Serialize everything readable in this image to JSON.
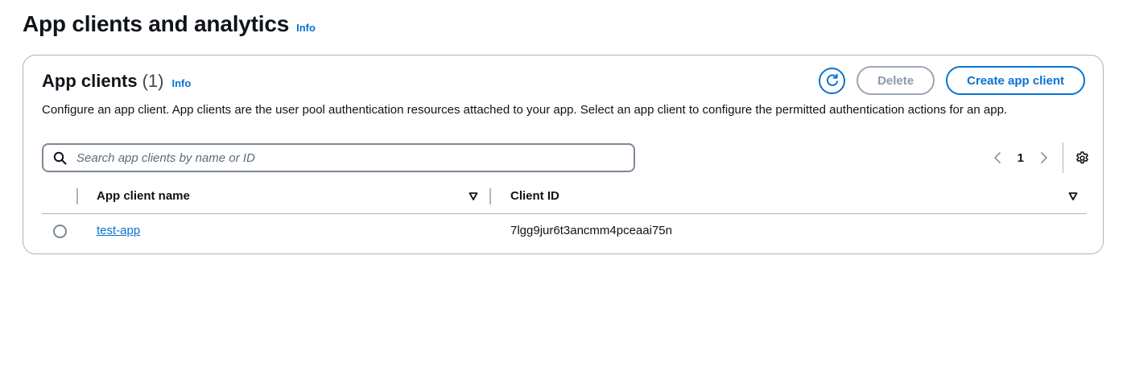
{
  "page": {
    "title": "App clients and analytics",
    "info_label": "Info"
  },
  "app_clients": {
    "title": "App clients",
    "count": "(1)",
    "info_label": "Info",
    "description": "Configure an app client. App clients are the user pool authentication resources attached to your app. Select an app client to configure the permitted authentication actions for an app.",
    "actions": {
      "refresh_icon": "refresh-icon",
      "delete_label": "Delete",
      "create_label": "Create app client"
    },
    "search": {
      "placeholder": "Search app clients by name or ID",
      "value": ""
    },
    "pagination": {
      "current_page": "1"
    },
    "table": {
      "columns": [
        "App client name",
        "Client ID"
      ],
      "rows": [
        {
          "name": "test-app",
          "client_id": "7lgg9jur6t3ancmm4pceaai75n"
        }
      ]
    }
  },
  "colors": {
    "accent": "#0972d3",
    "text": "#0f141a",
    "border": "#b4b4bb",
    "disabled": "#8d99a8"
  }
}
